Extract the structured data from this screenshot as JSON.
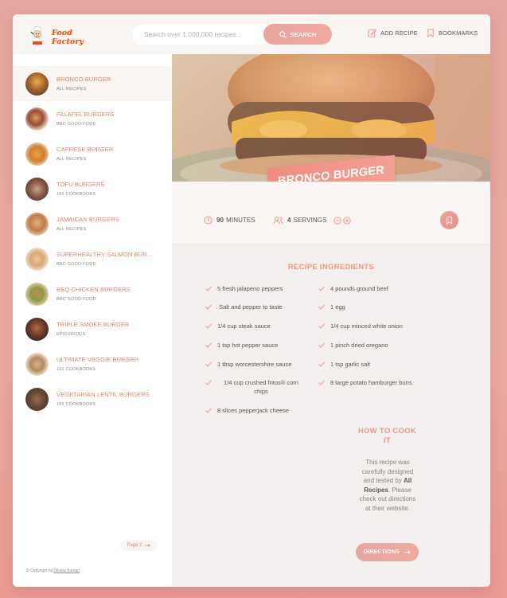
{
  "header": {
    "logo_text": "Food Factory",
    "search_placeholder": "Search over 1,000,000 recipes...",
    "search_label": "SEARCH",
    "add_recipe_label": "ADD RECIPE",
    "bookmarks_label": "BOOKMARKS"
  },
  "sidebar": {
    "results": [
      {
        "title": "BRONCO BURGER",
        "publisher": "ALL RECIPES",
        "active": true
      },
      {
        "title": "FALAFEL BURGERS",
        "publisher": "BBC GOOD FOOD"
      },
      {
        "title": "CAPRESE BURGER",
        "publisher": "ALL RECIPES"
      },
      {
        "title": "TOFU BURGERS",
        "publisher": "101 COOKBOOKS"
      },
      {
        "title": "JAMAICAN BURGERS",
        "publisher": "ALL RECIPES"
      },
      {
        "title": "SUPERHEALTHY SALMON BURGE...",
        "publisher": "BBC GOOD FOOD"
      },
      {
        "title": "BBQ CHICKEN BURGERS",
        "publisher": "BBC GOOD FOOD"
      },
      {
        "title": "TRIPLE SMOKE BURGER",
        "publisher": "EPICURIOUS"
      },
      {
        "title": "ULTIMATE VEGGIE BURGER",
        "publisher": "101 COOKBOOKS"
      },
      {
        "title": "VEGETARIAN LENTIL BURGERS",
        "publisher": "101 COOKBOOKS"
      }
    ],
    "pagination_label": "Page 2",
    "copyright_prefix": "© Copyright by",
    "copyright_author": "Diksha Kumari"
  },
  "recipe": {
    "title": "BRONCO BURGER",
    "minutes": "90",
    "minutes_label": "MINUTES",
    "servings": "4",
    "servings_label": "SERVINGS",
    "ingredients_title": "RECIPE INGREDIENTS",
    "ingredients": [
      "5 fresh jalapeno peppers",
      "4 pounds ground beef",
      " Salt and pepper to taste",
      "1 egg",
      "1/4 cup steak sauce",
      "1/4 cup minced white onion",
      "1 tsp hot pepper sauce",
      "1 pinch dried oregano",
      "1 tbsp worcestershire sauce",
      "1 tsp garlic salt",
      "1/4 cup crushed fritos® corn chips",
      "8 large potato hamburger buns",
      "8 slices pepperjack cheese"
    ],
    "cook_title": "HOW TO COOK IT",
    "cook_text_before": "This recipe was carefully designed and tested by",
    "cook_publisher": "All Recipes",
    "cook_text_after": ". Please check out directions at their website.",
    "directions_label": "DIRECTIONS"
  },
  "colors": {
    "accent": "#f38e82",
    "accent_light": "#fbdb89",
    "text": "#615551",
    "muted": "#8d847f"
  }
}
